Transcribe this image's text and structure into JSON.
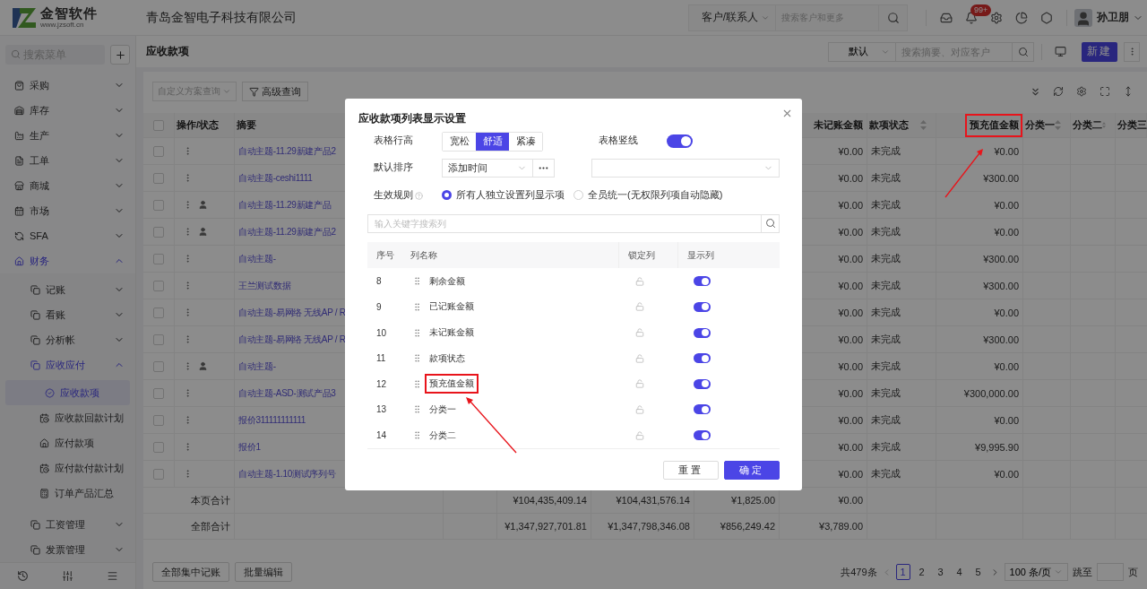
{
  "topbar": {
    "logo_name": "金智软件",
    "logo_url": "www.jzsoft.cn",
    "company": "青岛金智电子科技有限公司",
    "search": {
      "scope": "客户/联系人",
      "placeholder": "搜索客户和更多"
    },
    "notification_badge": "99+",
    "user": "孙卫朋"
  },
  "sidebar": {
    "search_placeholder": "搜索菜单",
    "menu": [
      {
        "label": "采购",
        "expanded": false,
        "selected": false
      },
      {
        "label": "库存",
        "expanded": false,
        "selected": false
      },
      {
        "label": "生产",
        "expanded": false,
        "selected": false
      },
      {
        "label": "工单",
        "expanded": false,
        "selected": false
      },
      {
        "label": "商城",
        "expanded": false,
        "selected": false
      },
      {
        "label": "市场",
        "expanded": false,
        "selected": false
      },
      {
        "label": "SFA",
        "expanded": false,
        "selected": false
      },
      {
        "label": "财务",
        "expanded": true,
        "selected": true,
        "children": [
          {
            "label": "记账",
            "expanded": false,
            "selected": false
          },
          {
            "label": "看账",
            "expanded": false,
            "selected": false
          },
          {
            "label": "分析帐",
            "expanded": false,
            "selected": false
          },
          {
            "label": "应收应付",
            "expanded": true,
            "selected": true,
            "children": [
              {
                "label": "应收款项",
                "selected": true
              },
              {
                "label": "应收款回款计划",
                "selected": false
              },
              {
                "label": "应付款项",
                "selected": false
              },
              {
                "label": "应付款付款计划",
                "selected": false
              },
              {
                "label": "订单产品汇总",
                "selected": false
              }
            ]
          },
          {
            "label": "工资管理",
            "expanded": false,
            "selected": false
          },
          {
            "label": "发票管理",
            "expanded": false,
            "selected": false
          }
        ]
      }
    ]
  },
  "page_header": {
    "title": "应收款项",
    "view_select": "默认",
    "search_placeholder": "搜索摘要、对应客户",
    "new_button": "新建"
  },
  "toolbar": {
    "scheme_placeholder": "自定义方案查询",
    "advanced_button": "高级查询"
  },
  "table": {
    "all_checked": false,
    "columns": [
      {
        "label": "操作/状态",
        "sortable": false,
        "highlighted": false
      },
      {
        "label": "摘要"
      },
      {
        "label": "未记账金额",
        "sortable": false,
        "highlighted": false
      },
      {
        "label": "款项状态",
        "sortable": true,
        "highlighted": false
      },
      {
        "label": "预充值金额",
        "sortable": false,
        "highlighted": true
      },
      {
        "label": "分类一",
        "sortable": true,
        "highlighted": false
      },
      {
        "label": "分类二",
        "sortable": true,
        "highlighted": false
      },
      {
        "label": "分类三"
      }
    ],
    "rows": [
      {
        "checked": false,
        "person": false,
        "summary": "自动主题-11.29新建产品2",
        "unposted": "¥0.00",
        "status": "未完成",
        "prepaid": "¥0.00"
      },
      {
        "checked": false,
        "person": false,
        "summary": "自动主题-ceshi1111",
        "unposted": "¥0.00",
        "status": "未完成",
        "prepaid": "¥300.00"
      },
      {
        "checked": false,
        "person": true,
        "summary": "自动主题-11.29新建产品",
        "unposted": "¥0.00",
        "status": "未完成",
        "prepaid": "¥0.00"
      },
      {
        "checked": false,
        "person": true,
        "summary": "自动主题-11.29新建产品2",
        "unposted": "¥0.00",
        "status": "未完成",
        "prepaid": "¥0.00"
      },
      {
        "checked": false,
        "person": false,
        "summary": "自动主题-",
        "unposted": "¥0.00",
        "status": "未完成",
        "prepaid": "¥300.00"
      },
      {
        "checked": false,
        "person": false,
        "summary": "王兰测试数据",
        "unposted": "¥0.00",
        "status": "未完成",
        "prepaid": "¥300.00"
      },
      {
        "checked": false,
        "person": false,
        "summary": "自动主题-易网络 无线AP / R",
        "unposted": "¥0.00",
        "status": "未完成",
        "prepaid": "¥0.00"
      },
      {
        "checked": false,
        "person": false,
        "summary": "自动主题-易网络 无线AP / R",
        "unposted": "¥0.00",
        "status": "未完成",
        "prepaid": "¥300.00"
      },
      {
        "checked": false,
        "person": true,
        "summary": "自动主题-",
        "unposted": "¥0.00",
        "status": "未完成",
        "prepaid": "¥0.00"
      },
      {
        "checked": false,
        "person": false,
        "summary": "自动主题-ASD-测试产品3",
        "unposted": "¥0.00",
        "status": "未完成",
        "prepaid": "¥300,000.00"
      },
      {
        "checked": false,
        "person": false,
        "summary": "报价311111111111",
        "unposted": "¥0.00",
        "status": "未完成",
        "prepaid": "¥0.00"
      },
      {
        "checked": false,
        "person": false,
        "summary": "报价1",
        "unposted": "¥0.00",
        "status": "未完成",
        "prepaid": "¥9,995.90"
      },
      {
        "checked": false,
        "person": false,
        "summary": "自动主题-1.10测试序列号",
        "unposted": "¥0.00",
        "status": "未完成",
        "prepaid": "¥0.00"
      }
    ],
    "totals": [
      {
        "label": "本页合计",
        "values": [
          "¥104,435,409.14",
          "¥104,431,576.14",
          "¥1,825.00",
          "¥0.00"
        ]
      },
      {
        "label": "全部合计",
        "values": [
          "¥1,347,927,701.81",
          "¥1,347,798,346.08",
          "¥856,249.42",
          "¥3,789.00"
        ]
      }
    ]
  },
  "footer": {
    "buttons": [
      "全部集中记账",
      "批量编辑"
    ],
    "total": "共479条",
    "pages": [
      {
        "label": "1",
        "selected": true
      },
      {
        "label": "2",
        "selected": false
      },
      {
        "label": "3",
        "selected": false
      },
      {
        "label": "4",
        "selected": false
      },
      {
        "label": "5",
        "selected": false
      }
    ],
    "page_size": "100 条/页",
    "jump_label": "跳至",
    "page_unit": "页"
  },
  "dialog": {
    "title": "应收款项列表显示设置",
    "row_height": {
      "label": "表格行高",
      "options": [
        {
          "label": "宽松",
          "selected": false
        },
        {
          "label": "舒适",
          "selected": true
        },
        {
          "label": "紧凑",
          "selected": false
        }
      ]
    },
    "vertical_lines": {
      "label": "表格竖线",
      "on": true
    },
    "default_sort": {
      "label": "默认排序",
      "value": "添加时间"
    },
    "rule": {
      "label": "生效规则",
      "options": [
        {
          "label": "所有人独立设置列显示项",
          "selected": true
        },
        {
          "label": "全员统一(无权限列项自动隐藏)",
          "selected": false
        }
      ]
    },
    "search_placeholder": "输入关键字搜索列",
    "columns": [
      "序号",
      "列名称",
      "锁定列",
      "显示列"
    ],
    "rows": [
      {
        "index": "8",
        "name": "剩余金额",
        "locked": false,
        "shown": true,
        "highlighted": false
      },
      {
        "index": "9",
        "name": "已记账金额",
        "locked": false,
        "shown": true,
        "highlighted": false
      },
      {
        "index": "10",
        "name": "未记账金额",
        "locked": false,
        "shown": true,
        "highlighted": false
      },
      {
        "index": "11",
        "name": "款项状态",
        "locked": false,
        "shown": true,
        "highlighted": false
      },
      {
        "index": "12",
        "name": "预充值金额",
        "locked": false,
        "shown": true,
        "highlighted": true
      },
      {
        "index": "13",
        "name": "分类一",
        "locked": false,
        "shown": true,
        "highlighted": false
      },
      {
        "index": "14",
        "name": "分类二",
        "locked": false,
        "shown": true,
        "highlighted": false
      }
    ],
    "buttons": [
      {
        "label": "重置",
        "kind": "secondary"
      },
      {
        "label": "确定",
        "kind": "primary"
      }
    ]
  }
}
